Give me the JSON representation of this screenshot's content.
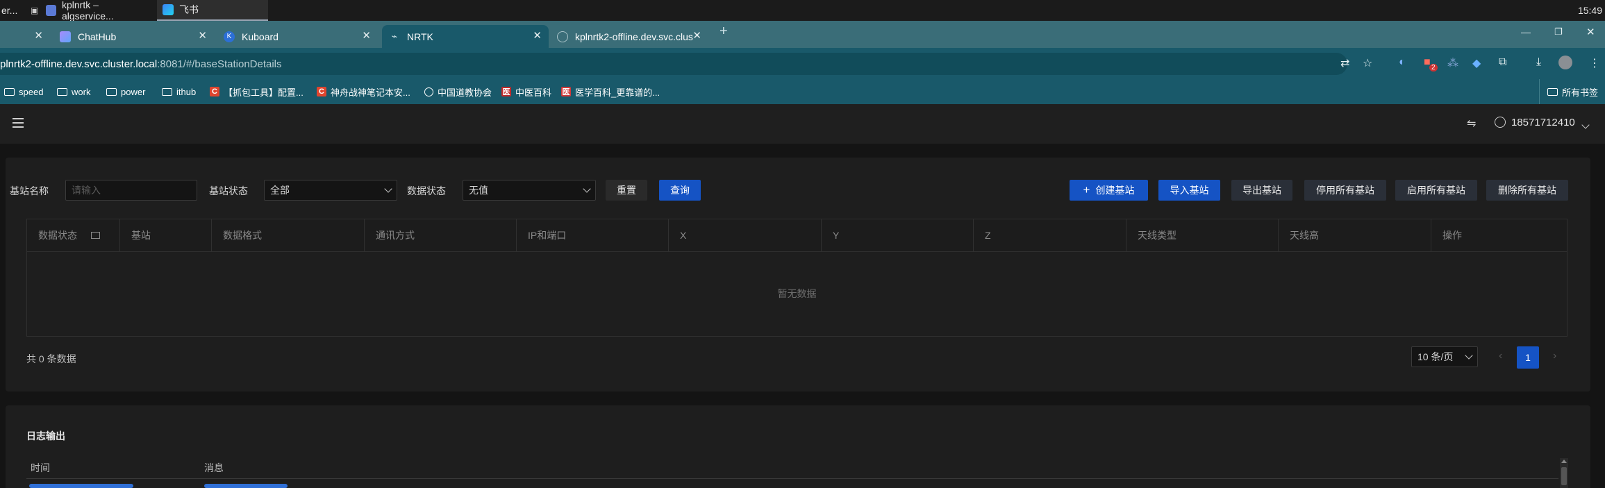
{
  "taskbar": {
    "items": [
      {
        "label": "er..."
      },
      {
        "label": "kplnrtk – algservice..."
      },
      {
        "label": "飞书"
      }
    ],
    "clock": "15:49"
  },
  "browser": {
    "tabs": [
      {
        "label": ""
      },
      {
        "label": "ChatHub"
      },
      {
        "label": "Kuboard"
      },
      {
        "label": "NRTK"
      },
      {
        "label": "kplnrtk2-offline.dev.svc.clust"
      }
    ],
    "new_tab": "+",
    "url_host": "plnrtk2-offline.dev.svc.cluster.local",
    "url_rest": ":8081/#/baseStationDetails",
    "profile_badge": "2",
    "bookmarks": [
      {
        "label": "speed",
        "icon": "folder-icon"
      },
      {
        "label": "work",
        "icon": "folder-icon"
      },
      {
        "label": "power",
        "icon": "folder-icon"
      },
      {
        "label": "ithub",
        "icon": "folder-icon"
      },
      {
        "label": "【抓包工具】配置...",
        "icon": "csdn-icon"
      },
      {
        "label": "神舟战神笔记本安...",
        "icon": "csdn-icon"
      },
      {
        "label": "中国道教协会",
        "icon": "globe-icon"
      },
      {
        "label": "中医百科",
        "icon": "tcm-icon"
      },
      {
        "label": "医学百科_更靠谱的...",
        "icon": "medical-icon"
      }
    ],
    "all_bookmarks": "所有书签"
  },
  "app": {
    "user_phone": "18571712410"
  },
  "filters": {
    "name_label": "基站名称",
    "name_placeholder": "请输入",
    "status_label": "基站状态",
    "status_value": "全部",
    "data_status_label": "数据状态",
    "data_status_value": "无值",
    "reset": "重置",
    "query": "查询"
  },
  "actions": {
    "create": "创建基站",
    "import": "导入基站",
    "export": "导出基站",
    "disable_all": "停用所有基站",
    "enable_all": "启用所有基站",
    "delete_all": "删除所有基站"
  },
  "table": {
    "columns": [
      "数据状态",
      "基站",
      "数据格式",
      "通讯方式",
      "IP和端口",
      "X",
      "Y",
      "Z",
      "天线类型",
      "天线高",
      "操作"
    ],
    "empty_text": "暂无数据"
  },
  "pagination": {
    "total": "共 0 条数据",
    "page_size": "10 条/页",
    "current_page": "1"
  },
  "log": {
    "title": "日志输出",
    "col_time": "时间",
    "col_message": "消息"
  },
  "colors": {
    "primary": "#1553c4",
    "tab_strip": "#3a6d78",
    "toolbar": "#19596a"
  }
}
